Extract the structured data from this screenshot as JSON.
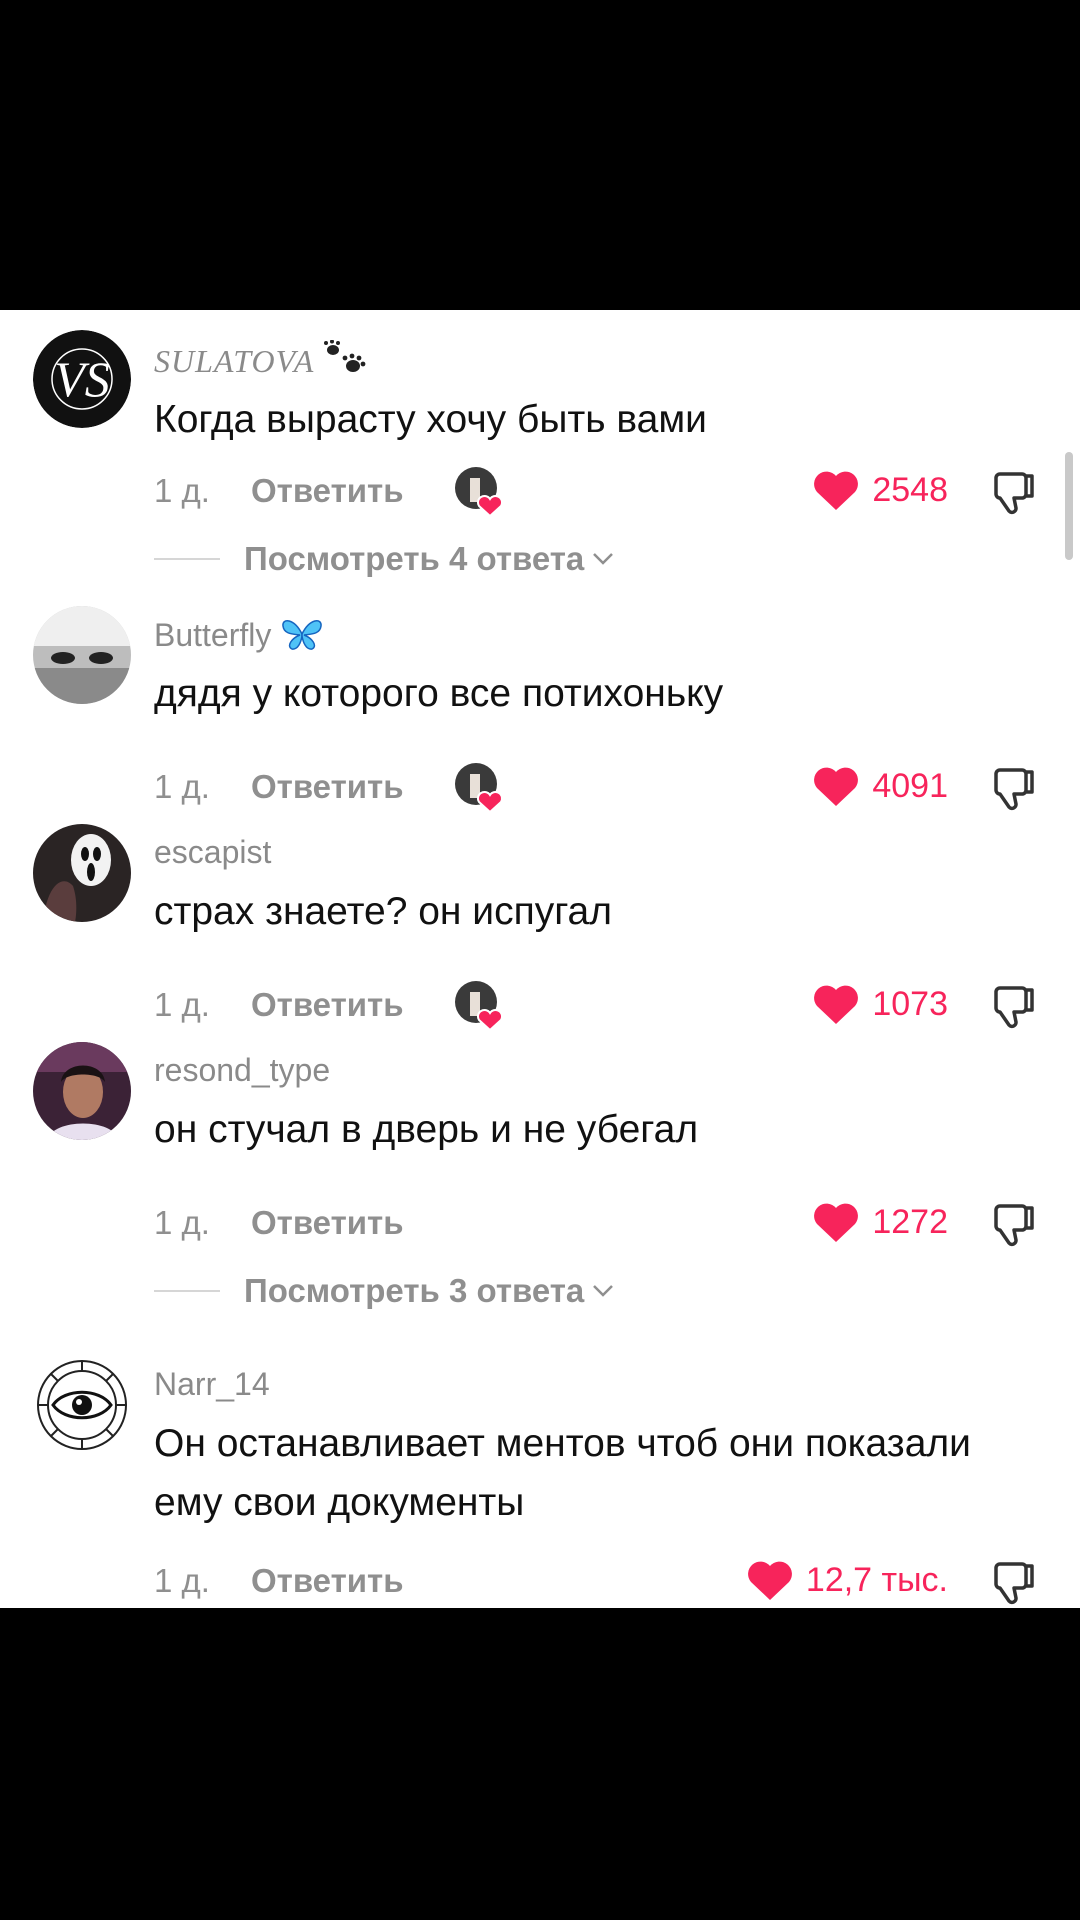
{
  "comments": [
    {
      "username": "SULATOVA",
      "username_suffix_icon": "paw-prints-icon",
      "text": "Когда вырасту хочу быть вами",
      "time": "1 д.",
      "reply_label": "Ответить",
      "creator_liked": true,
      "likes": "2548",
      "view_replies": "Посмотреть 4 ответа"
    },
    {
      "username": "Butterfly",
      "username_suffix_icon": "butterfly-icon",
      "text": "дядя у которого все потихоньку",
      "time": "1 д.",
      "reply_label": "Ответить",
      "creator_liked": true,
      "likes": "4091"
    },
    {
      "username": "escapist",
      "text": "страх знаете? он испугал",
      "time": "1 д.",
      "reply_label": "Ответить",
      "creator_liked": true,
      "likes": "1073"
    },
    {
      "username": "resond_type",
      "text": "он стучал в дверь и не убегал",
      "time": "1 д.",
      "reply_label": "Ответить",
      "creator_liked": false,
      "likes": "1272",
      "view_replies": "Посмотреть 3 ответа"
    },
    {
      "username": "Narr_14",
      "text": "Он останавливает ментов чтоб они показали ему свои документы",
      "time": "1 д.",
      "reply_label": "Ответить",
      "creator_liked": false,
      "likes": "12,7 тыс."
    }
  ],
  "colors": {
    "like_red": "#f7245b",
    "meta_gray": "#8f8f8f",
    "text": "#111111",
    "letterbox": "#000000"
  }
}
